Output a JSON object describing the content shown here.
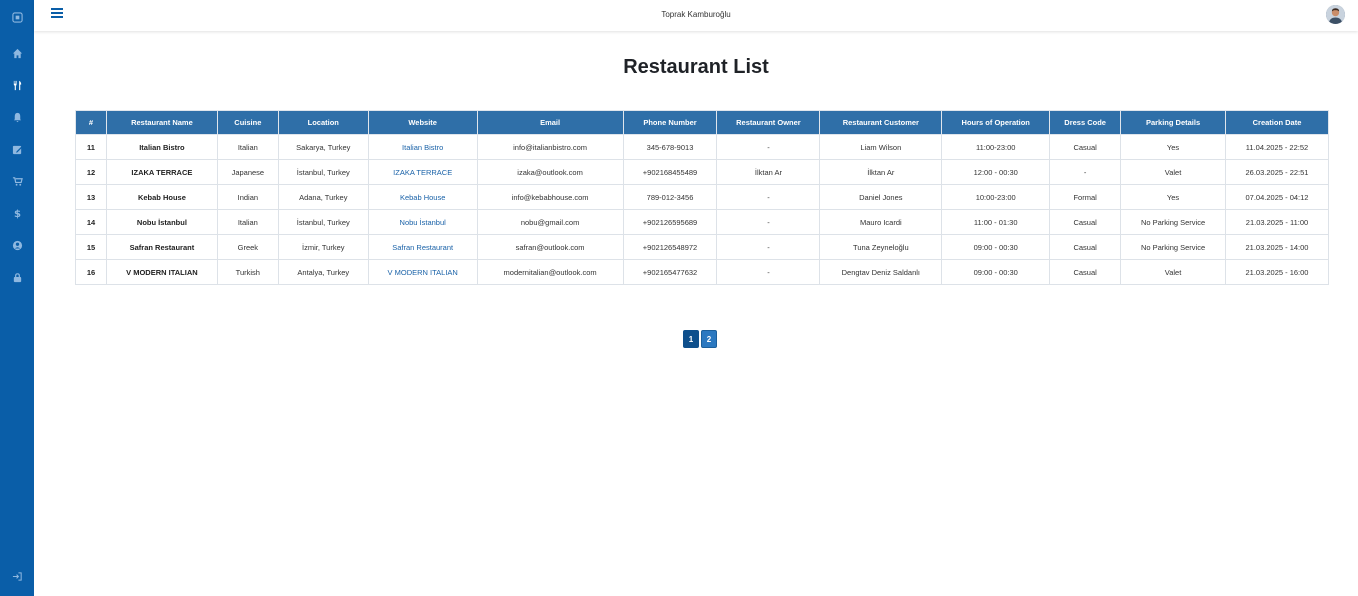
{
  "header": {
    "user_name": "Toprak Kamburoğlu"
  },
  "page": {
    "title": "Restaurant List"
  },
  "sidebar": {
    "items": [
      {
        "name": "logo-icon"
      },
      {
        "name": "home-icon"
      },
      {
        "name": "restaurant-icon"
      },
      {
        "name": "bell-icon"
      },
      {
        "name": "edit-icon"
      },
      {
        "name": "cart-icon"
      },
      {
        "name": "dollar-icon"
      },
      {
        "name": "user-icon"
      },
      {
        "name": "lock-icon"
      },
      {
        "name": "logout-icon"
      }
    ]
  },
  "table": {
    "columns": [
      "#",
      "Restaurant Name",
      "Cuisine",
      "Location",
      "Website",
      "Email",
      "Phone Number",
      "Restaurant Owner",
      "Restaurant Customer",
      "Hours of Operation",
      "Dress Code",
      "Parking Details",
      "Creation Date"
    ],
    "rows": [
      [
        "11",
        "Italian Bistro",
        "Italian",
        "Sakarya, Turkey",
        "Italian Bistro",
        "info@italianbistro.com",
        "345-678-9013",
        "-",
        "Liam Wilson",
        "11:00-23:00",
        "Casual",
        "Yes",
        "11.04.2025 - 22:52"
      ],
      [
        "12",
        "IZAKA TERRACE",
        "Japanese",
        "İstanbul, Turkey",
        "IZAKA TERRACE",
        "izaka@outlook.com",
        "+902168455489",
        "İlktan Ar",
        "İlktan Ar",
        "12:00 - 00:30",
        "-",
        "Valet",
        "26.03.2025 - 22:51"
      ],
      [
        "13",
        "Kebab House",
        "Indian",
        "Adana, Turkey",
        "Kebab House",
        "info@kebabhouse.com",
        "789-012-3456",
        "-",
        "Daniel Jones",
        "10:00-23:00",
        "Formal",
        "Yes",
        "07.04.2025 - 04:12"
      ],
      [
        "14",
        "Nobu İstanbul",
        "Italian",
        "İstanbul, Turkey",
        "Nobu İstanbul",
        "nobu@gmail.com",
        "+902126595689",
        "-",
        "Mauro Icardi",
        "11:00 - 01:30",
        "Casual",
        "No Parking Service",
        "21.03.2025 - 11:00"
      ],
      [
        "15",
        "Safran Restaurant",
        "Greek",
        "İzmir, Turkey",
        "Safran Restaurant",
        "safran@outlook.com",
        "+902126548972",
        "-",
        "Tuna Zeyneloğlu",
        "09:00 - 00:30",
        "Casual",
        "No Parking Service",
        "21.03.2025 - 14:00"
      ],
      [
        "16",
        "V MODERN ITALIAN",
        "Turkish",
        "Antalya, Turkey",
        "V MODERN ITALIAN",
        "modernitalian@outlook.com",
        "+902165477632",
        "-",
        "Dengtav Deniz Saldanlı",
        "09:00 - 00:30",
        "Casual",
        "Valet",
        "21.03.2025 - 16:00"
      ]
    ]
  },
  "pagination": {
    "pages": [
      "1",
      "2"
    ],
    "active": "2"
  },
  "colors": {
    "sidebar": "#0a5ea8",
    "header_row": "#2f6fa8",
    "link": "#1a62a8"
  }
}
